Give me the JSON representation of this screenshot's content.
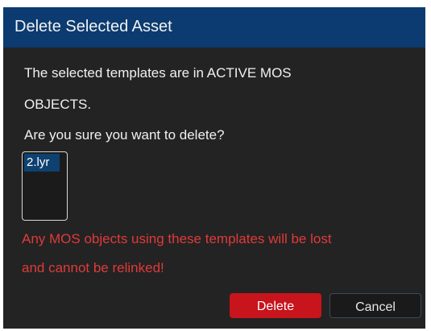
{
  "dialog": {
    "title": "Delete Selected Asset",
    "message_line1": "The selected templates are in ACTIVE MOS",
    "message_line2": "OBJECTS.",
    "question": "Are you sure you want to delete?",
    "items": [
      "2.lyr"
    ],
    "warning_line1": "Any MOS objects using these templates will be lost",
    "warning_line2": "and cannot be relinked!",
    "delete_label": "Delete",
    "cancel_label": "Cancel"
  },
  "colors": {
    "title_bar": "#0b3b70",
    "background": "#232323",
    "warning": "#e03a3a",
    "delete_button": "#c8141c"
  }
}
